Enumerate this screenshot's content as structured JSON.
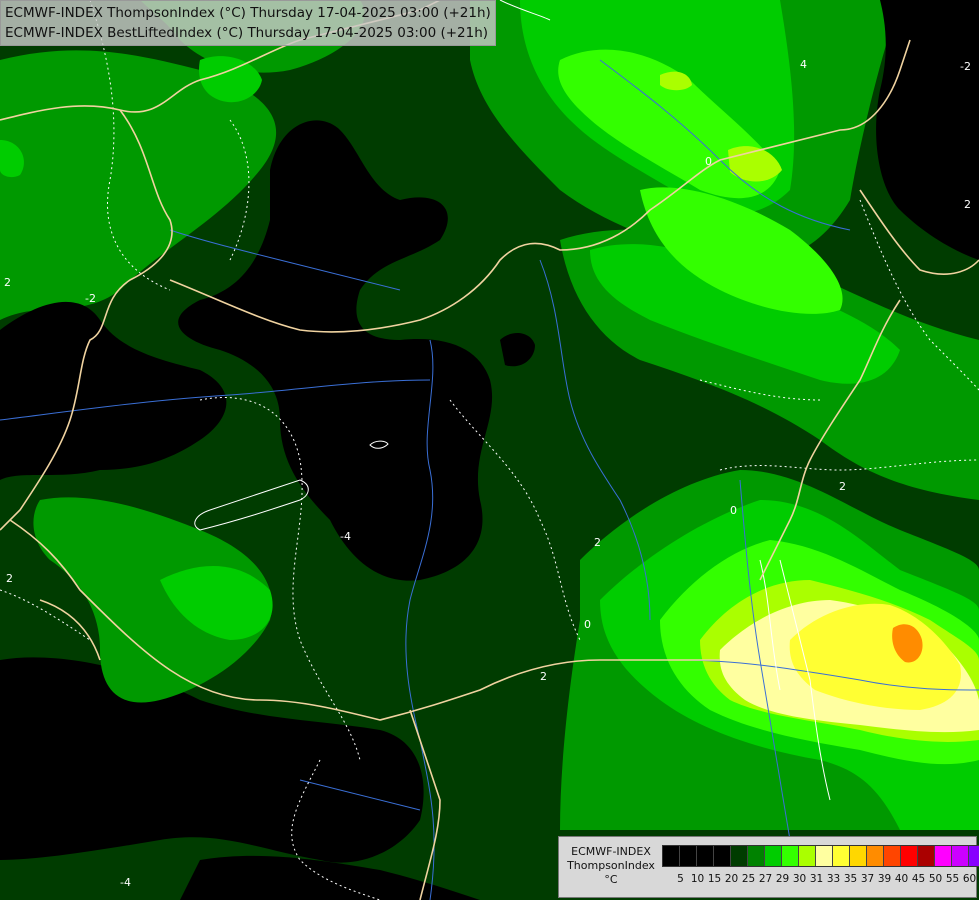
{
  "header": {
    "line1": "ECMWF-INDEX ThompsonIndex (°C) Thursday 17-04-2025 03:00 (+21h)",
    "line2": "ECMWF-INDEX BestLiftedIndex (°C) Thursday 17-04-2025 03:00 (+21h)"
  },
  "legend": {
    "model": "ECMWF-INDEX",
    "parameter": "ThompsonIndex",
    "unit": "°C",
    "colors": [
      "#000000",
      "#000000",
      "#000000",
      "#000000",
      "#003c00",
      "#008200",
      "#00cc00",
      "#33ff00",
      "#aaff00",
      "#ffffa0",
      "#ffff33",
      "#ffd700",
      "#ff8c00",
      "#ff4500",
      "#ff0000",
      "#aa0000",
      "#ff00ff",
      "#cc00ff",
      "#8800ff",
      "#5500ff",
      "#0000ff"
    ],
    "ticks": [
      "5",
      "10",
      "15",
      "20",
      "25",
      "27",
      "29",
      "30",
      "31",
      "33",
      "35",
      "37",
      "39",
      "40",
      "45",
      "50",
      "55",
      "60"
    ]
  },
  "contour_labels": [
    "2",
    "2",
    "2",
    "2",
    "0",
    "0",
    "-2",
    "-4",
    "2",
    "0",
    "2",
    "4",
    "-2",
    "-4"
  ],
  "palette": {
    "black": "#000000",
    "dark_green": "#003c00",
    "mid_green": "#005f00",
    "green": "#009900",
    "bright_green": "#00cc00",
    "lime": "#33ff00",
    "yellow_green": "#aaff00",
    "pale_yellow": "#ffffa0",
    "yellow": "#ffff33",
    "orange": "#ff8c00",
    "border": "#f0d3a0",
    "river": "#3a6fd6",
    "contour": "#ffffff"
  }
}
